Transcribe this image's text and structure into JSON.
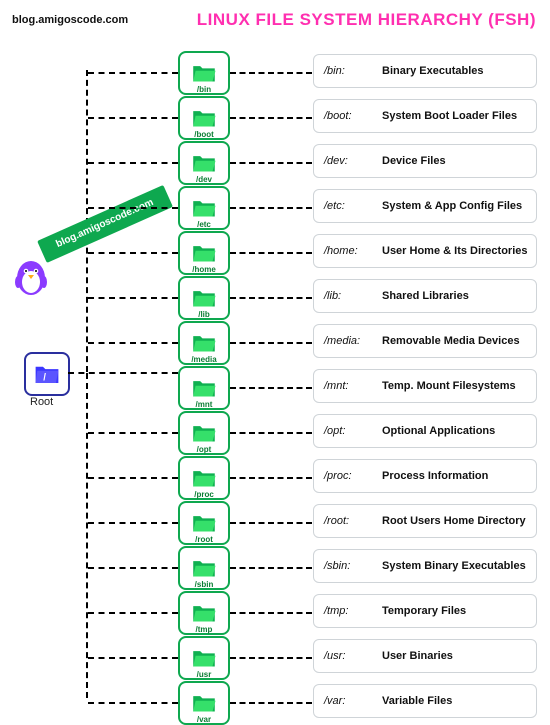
{
  "site": "blog.amigoscode.com",
  "title": "LINUX FILE SYSTEM HIERARCHY (FSH)",
  "root": {
    "label": "/",
    "caption": "Root"
  },
  "watermark": "blog.amigoscode.com",
  "directories": [
    {
      "name": "/bin",
      "key": "/bin:",
      "desc": "Binary Executables"
    },
    {
      "name": "/boot",
      "key": "/boot:",
      "desc": "System Boot Loader Files"
    },
    {
      "name": "/dev",
      "key": "/dev:",
      "desc": "Device Files"
    },
    {
      "name": "/etc",
      "key": "/etc:",
      "desc": "System & App Config Files"
    },
    {
      "name": "/home",
      "key": "/home:",
      "desc": "User Home & Its Directories"
    },
    {
      "name": "/lib",
      "key": "/lib:",
      "desc": "Shared Libraries"
    },
    {
      "name": "/media",
      "key": "/media:",
      "desc": "Removable Media Devices"
    },
    {
      "name": "/mnt",
      "key": "/mnt:",
      "desc": "Temp. Mount Filesystems"
    },
    {
      "name": "/opt",
      "key": "/opt:",
      "desc": "Optional Applications"
    },
    {
      "name": "/proc",
      "key": "/proc:",
      "desc": "Process Information"
    },
    {
      "name": "/root",
      "key": "/root:",
      "desc": "Root Users Home Directory"
    },
    {
      "name": "/sbin",
      "key": "/sbin:",
      "desc": "System Binary Executables"
    },
    {
      "name": "/tmp",
      "key": "/tmp:",
      "desc": "Temporary Files"
    },
    {
      "name": "/usr",
      "key": "/usr:",
      "desc": "User Binaries"
    },
    {
      "name": "/var",
      "key": "/var:",
      "desc": "Variable Files"
    }
  ]
}
